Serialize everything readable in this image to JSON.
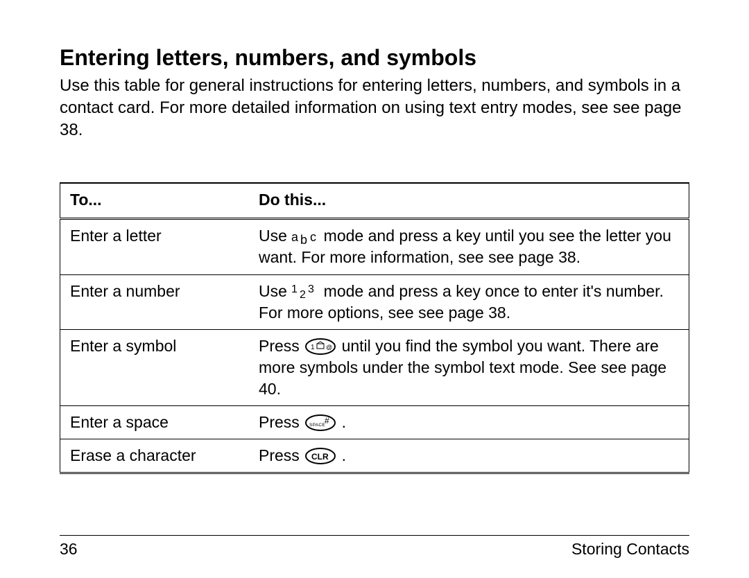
{
  "heading": "Entering letters, numbers, and symbols",
  "intro": "Use this table for general instructions for entering letters, numbers, and symbols in a contact card. For more detailed information on using text entry modes, see see page 38.",
  "table": {
    "headers": {
      "to": "To...",
      "do": "Do this..."
    },
    "rows": [
      {
        "to": "Enter a letter",
        "do_pre": "Use ",
        "icon": "abc",
        "do_post": " mode and press a key until you see the letter you want. For more information, see see page 38."
      },
      {
        "to": "Enter a number",
        "do_pre": "Use ",
        "icon": "123",
        "do_post": " mode and press a key once to enter it's number. For more options, see see page 38."
      },
      {
        "to": "Enter a symbol",
        "do_pre": "Press ",
        "icon": "key-1",
        "do_post": " until you find the symbol you want. There are more symbols under the symbol text mode. See see page 40."
      },
      {
        "to": "Enter a space",
        "do_pre": "Press ",
        "icon": "key-space",
        "do_post": " ."
      },
      {
        "to": "Erase a character",
        "do_pre": "Press ",
        "icon": "key-clr",
        "do_post": " ."
      }
    ]
  },
  "footer": {
    "page_number": "36",
    "section": "Storing Contacts"
  }
}
